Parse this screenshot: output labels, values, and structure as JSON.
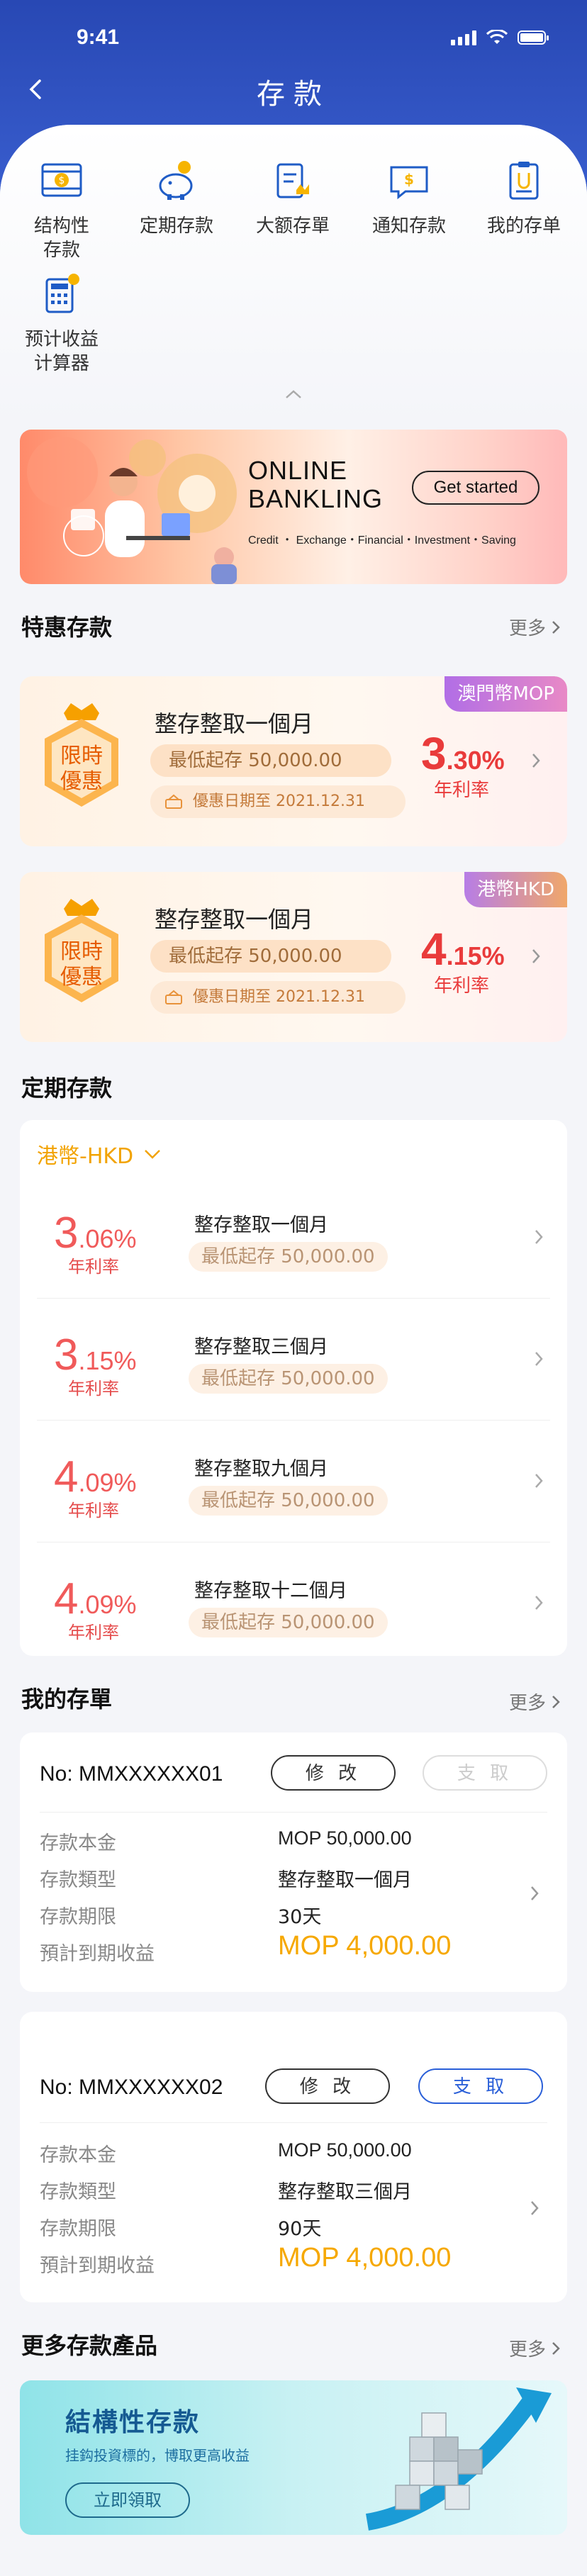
{
  "status_bar": {
    "time": "9:41"
  },
  "header": {
    "title": "存款"
  },
  "quick_actions": [
    {
      "label": "结构性\n存款",
      "icon": "structured-deposit-icon"
    },
    {
      "label": "定期存款",
      "icon": "piggy-bank-icon"
    },
    {
      "label": "大额存單",
      "icon": "large-certificate-icon"
    },
    {
      "label": "通知存款",
      "icon": "notice-chat-icon"
    },
    {
      "label": "我的存单",
      "icon": "my-certificate-icon"
    },
    {
      "label": "预计收益\n计算器",
      "icon": "calculator-icon"
    }
  ],
  "banner": {
    "title_line1": "ONLINE",
    "title_line2": "BANKLING",
    "button": "Get started",
    "subtitle": "Credit ・ Exchange・Financial・Investment・Saving"
  },
  "promo_section": {
    "title": "特惠存款",
    "more": "更多"
  },
  "promos": [
    {
      "tag": "澳門幣MOP",
      "tag_color": "#c067e0",
      "badge_line1": "限時",
      "badge_line2": "優惠",
      "name": "整存整取一個月",
      "min": "最低起存  50,000.00",
      "date": "優惠日期至 2021.12.31",
      "rate_big": "3",
      "rate_small": ".30%",
      "rate_label": "年利率"
    },
    {
      "tag": "港幣HKD",
      "tag_color": "#c78ae6",
      "badge_line1": "限時",
      "badge_line2": "優惠",
      "name": "整存整取一個月",
      "min": "最低起存  50,000.00",
      "date": "優惠日期至 2021.12.31",
      "rate_big": "4",
      "rate_small": ".15%",
      "rate_label": "年利率"
    }
  ],
  "fixed_section": {
    "title": "定期存款",
    "currency": "港幣-HKD"
  },
  "fixed_rows": [
    {
      "rate_big": "3",
      "rate_small": ".06%",
      "rate_label": "年利率",
      "name": "整存整取一個月",
      "min": "最低起存  50,000.00"
    },
    {
      "rate_big": "3",
      "rate_small": ".15%",
      "rate_label": "年利率",
      "name": "整存整取三個月",
      "min": "最低起存  50,000.00"
    },
    {
      "rate_big": "4",
      "rate_small": ".09%",
      "rate_label": "年利率",
      "name": "整存整取九個月",
      "min": "最低起存  50,000.00"
    },
    {
      "rate_big": "4",
      "rate_small": ".09%",
      "rate_label": "年利率",
      "name": "整存整取十二個月",
      "min": "最低起存  50,000.00"
    }
  ],
  "my_section": {
    "title": "我的存單",
    "more": "更多"
  },
  "my_deposits": [
    {
      "no": "No: MMXXXXXX01",
      "edit": "修 改",
      "withdraw": "支 取",
      "withdraw_enabled": false,
      "k1": "存款本金",
      "v1": "MOP 50,000.00",
      "k2": "存款類型",
      "v2": "整存整取一個月",
      "k3": "存款期限",
      "v3": "30天",
      "k4": "預計到期收益",
      "v4": "MOP 4,000.00"
    },
    {
      "no": "No: MMXXXXXX02",
      "edit": "修 改",
      "withdraw": "支 取",
      "withdraw_enabled": true,
      "k1": "存款本金",
      "v1": "MOP 50,000.00",
      "k2": "存款類型",
      "v2": "整存整取三個月",
      "k3": "存款期限",
      "v3": "90天",
      "k4": "預計到期收益",
      "v4": "MOP 4,000.00"
    }
  ],
  "more_products": {
    "title": "更多存款產品",
    "more": "更多",
    "card_title": "結構性存款",
    "card_sub": "挂鈎投資標的，博取更高收益",
    "card_button": "立即領取"
  },
  "colors": {
    "brand_blue": "#2848b4",
    "rate_red": "#e93b3b",
    "amount_orange": "#f6a800",
    "currency_orange": "#f2a300"
  }
}
